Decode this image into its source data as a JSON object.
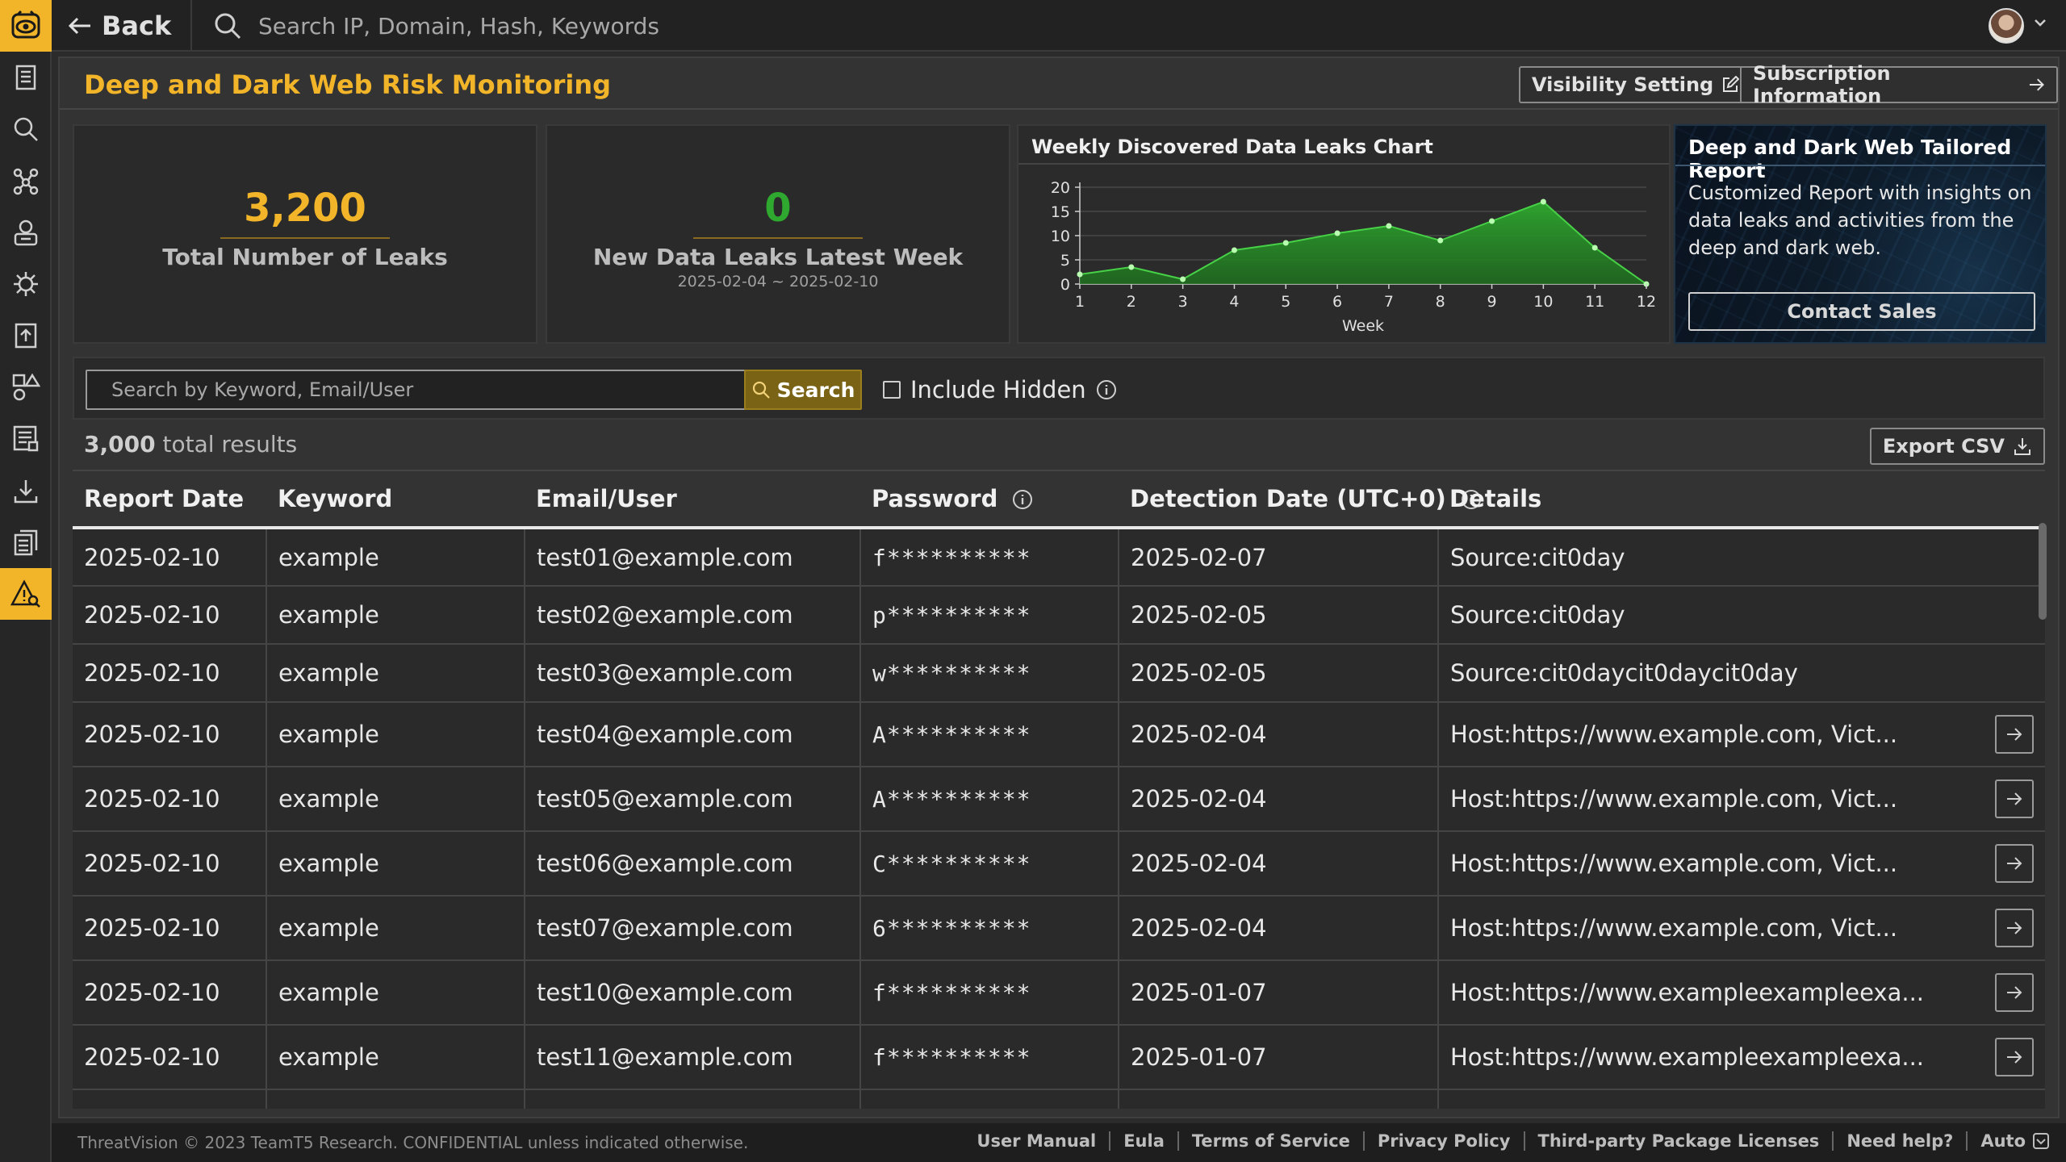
{
  "topbar": {
    "back_label": "Back",
    "search_placeholder": "Search IP, Domain, Hash, Keywords"
  },
  "page": {
    "title": "Deep and Dark Web Risk Monitoring",
    "visibility_setting": "Visibility Setting",
    "subscription_information": "Subscription Information"
  },
  "stats": {
    "total_leaks": {
      "value": "3,200",
      "label": "Total Number of Leaks"
    },
    "new_leaks": {
      "value": "0",
      "label": "New Data Leaks Latest Week",
      "range": "2025-02-04 ~ 2025-02-10"
    }
  },
  "chart_data": {
    "type": "area",
    "title": "Weekly Discovered Data Leaks Chart",
    "xlabel": "Week",
    "ylabel": "",
    "x": [
      1,
      2,
      3,
      4,
      5,
      6,
      7,
      8,
      9,
      10,
      11,
      12
    ],
    "values": [
      2,
      3.5,
      1,
      7,
      8.5,
      10.5,
      12,
      9,
      13,
      17,
      7.5,
      0
    ],
    "ylim": [
      0,
      20
    ],
    "yticks": [
      0,
      5,
      10,
      15,
      20
    ],
    "grid": true,
    "color": "#2ea82e"
  },
  "report": {
    "title": "Deep and Dark Web Tailored Report",
    "description": "Customized Report with insights on data leaks and activities from the deep and dark web.",
    "contact_label": "Contact Sales"
  },
  "filters": {
    "keyword_placeholder": "Search by Keyword, Email/User",
    "search_label": "Search",
    "include_hidden_label": "Include Hidden"
  },
  "results": {
    "count": "3,000",
    "suffix": " total results",
    "export_label": "Export CSV"
  },
  "table": {
    "headers": {
      "report_date": "Report Date",
      "keyword": "Keyword",
      "email": "Email/User",
      "password": "Password",
      "detection": "Detection Date (UTC+0)",
      "details": "Details"
    },
    "rows": [
      {
        "report_date": "2025-02-10",
        "keyword": "example",
        "email": "test01@example.com",
        "password": "f**********",
        "detection": "2025-02-07",
        "details": "Source:cit0day",
        "link": false
      },
      {
        "report_date": "2025-02-10",
        "keyword": "example",
        "email": "test02@example.com",
        "password": "p**********",
        "detection": "2025-02-05",
        "details": "Source:cit0day",
        "link": false
      },
      {
        "report_date": "2025-02-10",
        "keyword": "example",
        "email": "test03@example.com",
        "password": "w**********",
        "detection": "2025-02-05",
        "details": "Source:cit0daycit0daycit0day",
        "link": false
      },
      {
        "report_date": "2025-02-10",
        "keyword": "example",
        "email": "test04@example.com",
        "password": "A**********",
        "detection": "2025-02-04",
        "details": "Host:https://www.example.com, Vict...",
        "link": true
      },
      {
        "report_date": "2025-02-10",
        "keyword": "example",
        "email": "test05@example.com",
        "password": "A**********",
        "detection": "2025-02-04",
        "details": "Host:https://www.example.com, Vict...",
        "link": true
      },
      {
        "report_date": "2025-02-10",
        "keyword": "example",
        "email": "test06@example.com",
        "password": "C**********",
        "detection": "2025-02-04",
        "details": "Host:https://www.example.com, Vict...",
        "link": true
      },
      {
        "report_date": "2025-02-10",
        "keyword": "example",
        "email": "test07@example.com",
        "password": "6**********",
        "detection": "2025-02-04",
        "details": "Host:https://www.example.com, Vict...",
        "link": true
      },
      {
        "report_date": "2025-02-10",
        "keyword": "example",
        "email": "test10@example.com",
        "password": "f**********",
        "detection": "2025-01-07",
        "details": "Host:https://www.exampleexampleexa...",
        "link": true
      },
      {
        "report_date": "2025-02-10",
        "keyword": "example",
        "email": "test11@example.com",
        "password": "f**********",
        "detection": "2025-01-07",
        "details": "Host:https://www.exampleexampleexa...",
        "link": true
      }
    ]
  },
  "footer": {
    "copyright": "ThreatVision © 2023 TeamT5 Research. CONFIDENTIAL unless indicated otherwise.",
    "links": [
      "User Manual",
      "Eula",
      "Terms of Service",
      "Privacy Policy",
      "Third-party Package Licenses",
      "Need help?"
    ],
    "auto_label": "Auto"
  },
  "sidebar": {
    "items": [
      "report-icon",
      "search-icon",
      "graph-icon",
      "actor-icon",
      "malware-icon",
      "upload-icon",
      "shapes-icon",
      "checklist-icon",
      "download-icon",
      "documents-icon",
      "warning-search-icon"
    ]
  },
  "colors": {
    "accent": "#f2b529",
    "success": "#2ea82e"
  }
}
